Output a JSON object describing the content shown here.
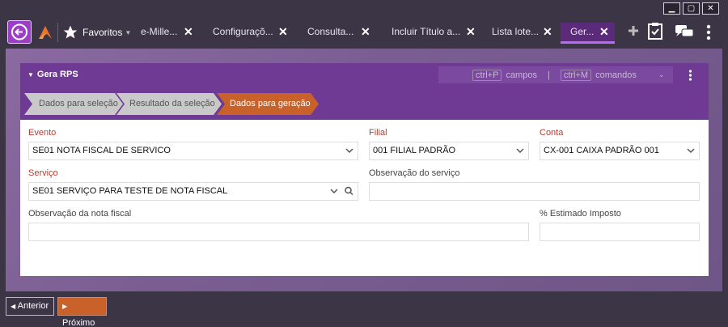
{
  "window": {
    "minimize": "▁",
    "maximize": "▢",
    "close": "✕"
  },
  "tabbar": {
    "favorites_label": "Favoritos",
    "tabs": [
      {
        "label": "e-Mille..."
      },
      {
        "label": "Configuraçõ..."
      },
      {
        "label": "Consulta..."
      },
      {
        "label": "Incluir Título a..."
      },
      {
        "label": "Lista lote..."
      },
      {
        "label": "Ger..."
      }
    ]
  },
  "panel": {
    "title": "Gera RPS",
    "shortcuts": {
      "k1": "ctrl+P",
      "l1": "campos",
      "sep": "|",
      "k2": "ctrl+M",
      "l2": "comandos"
    },
    "steps": [
      "Dados para seleção",
      "Resultado da seleção",
      "Dados para geração"
    ]
  },
  "form": {
    "evento": {
      "label": "Evento",
      "value": "SE01 NOTA FISCAL DE SERVICO"
    },
    "filial": {
      "label": "Filial",
      "value": "001 FILIAL PADRÃO"
    },
    "conta": {
      "label": "Conta",
      "value": "CX-001 CAIXA PADRÃO 001"
    },
    "servico": {
      "label": "Serviço",
      "value": "SE01 SERVIÇO PARA TESTE DE NOTA FISCAL"
    },
    "obs_servico": {
      "label": "Observação do serviço",
      "value": ""
    },
    "obs_nota": {
      "label": "Observação da nota fiscal",
      "value": ""
    },
    "imposto": {
      "label": "% Estimado Imposto",
      "value": ""
    }
  },
  "footer": {
    "prev": "Anterior",
    "next": "Próximo"
  },
  "colors": {
    "accent": "#6e3a94",
    "step_current": "#c8622a",
    "required": "#c0392b"
  }
}
